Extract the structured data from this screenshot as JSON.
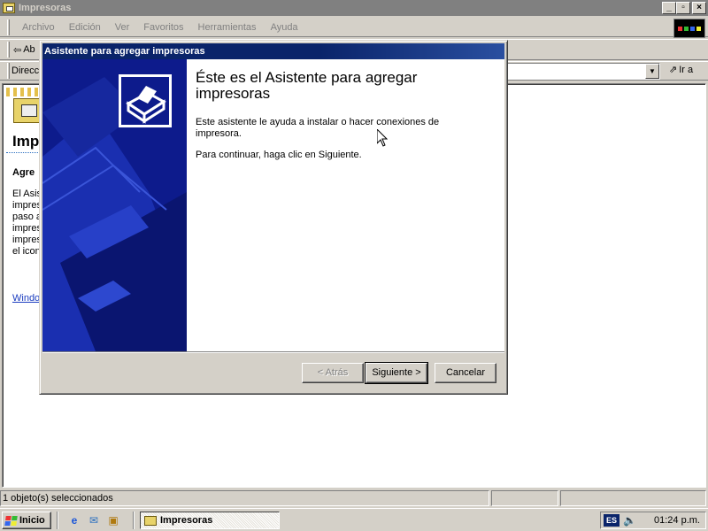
{
  "window": {
    "title": "Impresoras",
    "buttons": {
      "minimize": "_",
      "restore": "▫",
      "close": "×"
    }
  },
  "menu": [
    "Archivo",
    "Edición",
    "Ver",
    "Favoritos",
    "Herramientas",
    "Ayuda"
  ],
  "toolbar": {
    "back_label": "Ab"
  },
  "address": {
    "label": "Direcci",
    "go_label": "Ir a",
    "value": ""
  },
  "content": {
    "title": "Imp",
    "subtitle": "Agre",
    "desc_lines": [
      "El Asis",
      "impres",
      "paso a",
      "impres",
      "impres",
      "el icon"
    ],
    "link": "Windo"
  },
  "status": {
    "text": "1 objeto(s) seleccionados"
  },
  "wizard": {
    "title": "Asistente para agregar impresoras",
    "heading": "Éste es el Asistente para agregar impresoras",
    "paragraph1": "Este asistente le ayuda a instalar o hacer conexiones de impresora.",
    "paragraph2": "Para continuar, haga clic en Siguiente.",
    "back_label": "< Atrás",
    "next_label": "Siguiente >",
    "cancel_label": "Cancelar"
  },
  "taskbar": {
    "start_label": "Inicio",
    "task_label": "Impresoras",
    "lang": "ES",
    "clock": "01:24 p.m."
  },
  "colors": {
    "title_active": "#0a246a",
    "wizard_side": "#0d1b8c",
    "face": "#d4d0c8"
  }
}
